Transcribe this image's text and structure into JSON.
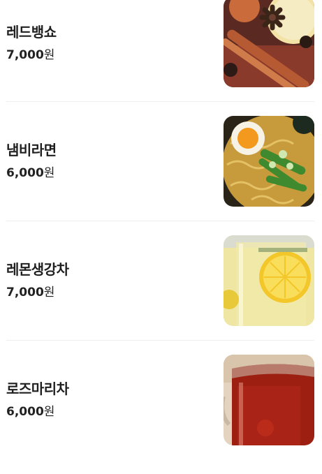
{
  "menu": {
    "items": [
      {
        "name": "레드뱅쇼",
        "price_amount": "7,000",
        "price_unit": "원",
        "image": "mulled-wine-photo"
      },
      {
        "name": "냄비라면",
        "price_amount": "6,000",
        "price_unit": "원",
        "image": "pot-ramen-photo"
      },
      {
        "name": "레몬생강차",
        "price_amount": "7,000",
        "price_unit": "원",
        "image": "lemon-ginger-tea-photo"
      },
      {
        "name": "로즈마리차",
        "price_amount": "6,000",
        "price_unit": "원",
        "image": "rosemary-tea-photo"
      }
    ]
  }
}
